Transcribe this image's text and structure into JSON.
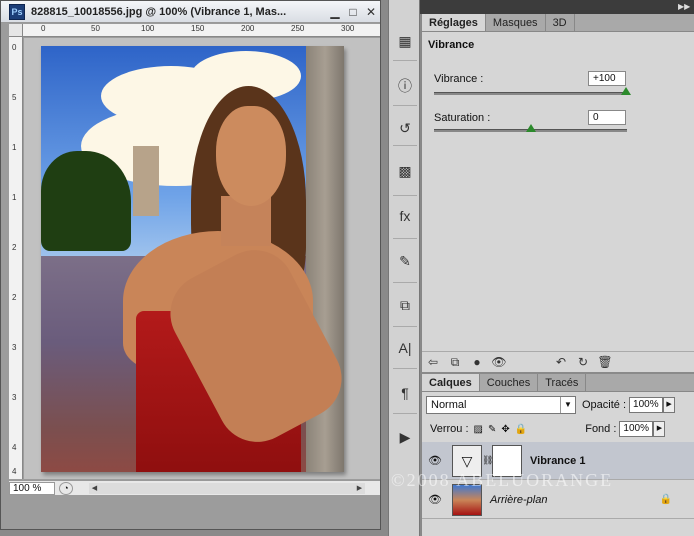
{
  "document": {
    "title": "828815_10018556.jpg @ 100% (Vibrance 1, Mas...",
    "app_icon": "Ps",
    "zoom": "100 %",
    "ruler_h_ticks": [
      "0",
      "50",
      "100",
      "150",
      "200",
      "250",
      "300"
    ],
    "ruler_v_ticks": [
      "0",
      "5",
      "1",
      "1",
      "2",
      "2",
      "3",
      "3",
      "4",
      "4"
    ]
  },
  "tools": [
    "histogram-icon",
    "info-icon",
    "history-icon",
    "swatches-icon",
    "styles-icon",
    "brush-icon",
    "clone-source-icon",
    "character-icon",
    "paragraph-icon",
    "actions-icon"
  ],
  "tool_glyphs": {
    "histogram-icon": "▦",
    "info-icon": "ⓘ",
    "history-icon": "↺",
    "swatches-icon": "▩",
    "styles-icon": "fx",
    "brush-icon": "✎",
    "clone-source-icon": "⧉",
    "character-icon": "A|",
    "paragraph-icon": "¶",
    "actions-icon": "▶"
  },
  "adjustments": {
    "tabs": [
      "Réglages",
      "Masques",
      "3D"
    ],
    "active_tab": "Réglages",
    "title": "Vibrance",
    "vibrance_label": "Vibrance :",
    "vibrance_value": "+100",
    "saturation_label": "Saturation :",
    "saturation_value": "0",
    "toolbar_icons": [
      "back-arrow-icon",
      "clip-to-layer-icon",
      "mask-icon",
      "visibility-eye-icon",
      "previous-state-icon",
      "reset-icon",
      "delete-icon"
    ]
  },
  "layers": {
    "tabs": [
      "Calques",
      "Couches",
      "Tracés"
    ],
    "active_tab": "Calques",
    "blend_mode": "Normal",
    "opacity_label": "Opacité :",
    "opacity_value": "100%",
    "lock_label": "Verrou :",
    "fill_label": "Fond :",
    "fill_value": "100%",
    "items": [
      {
        "name": "Vibrance 1",
        "selected": true
      },
      {
        "name": "Arrière-plan",
        "selected": false
      }
    ]
  },
  "watermark": "©2008 ABELUORANGE"
}
